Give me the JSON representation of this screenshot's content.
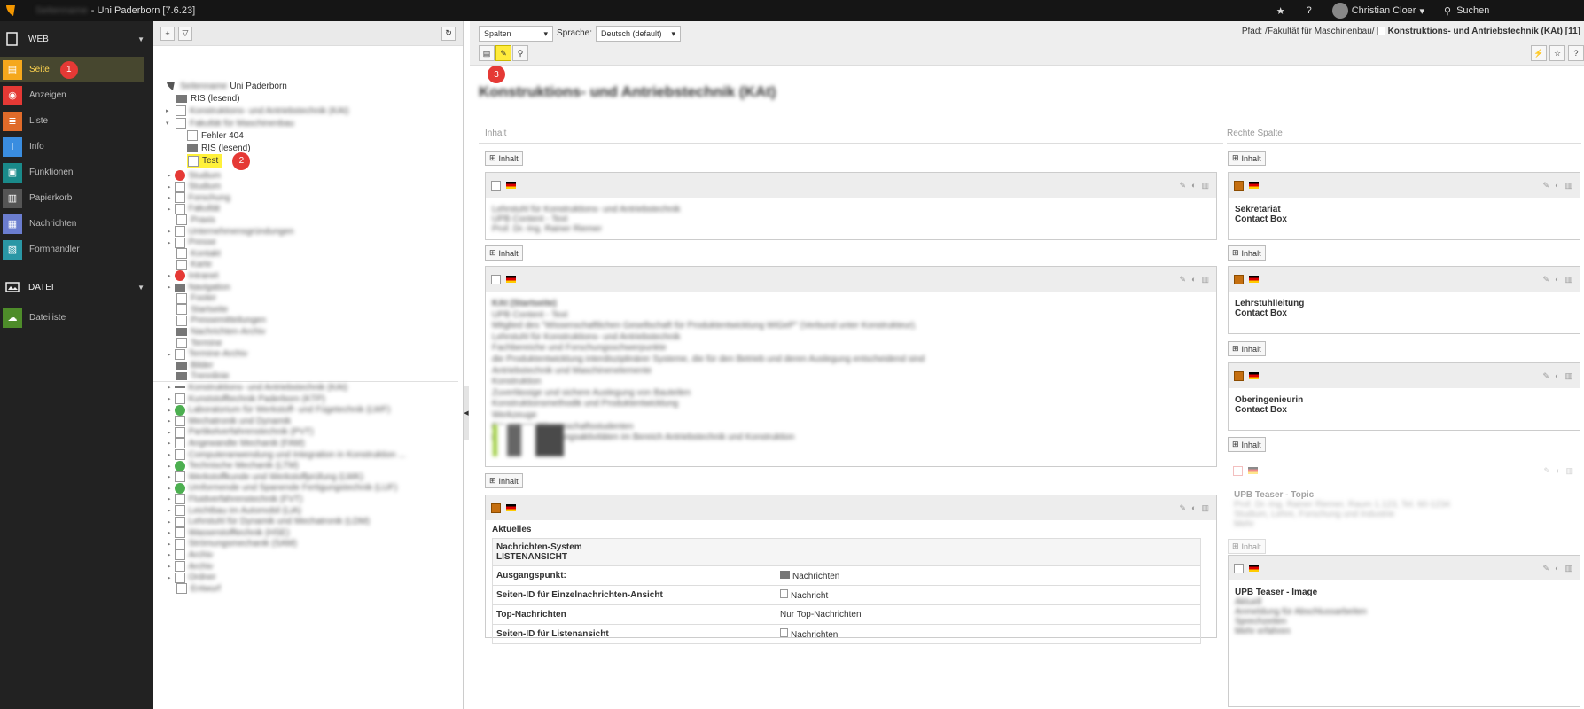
{
  "topbar": {
    "site_name_blurred": "Seitenname",
    "site_name": "- Uni Paderborn [7.6.23]",
    "bookmark_icon": "star-icon",
    "help_icon": "help-icon",
    "user_name": "Christian Cloer",
    "search_label": "Suchen"
  },
  "modules": {
    "web_group": "WEB",
    "file_group": "DATEI",
    "items": [
      {
        "label": "Seite",
        "icon": "page-icon",
        "color": "#f5a81c"
      },
      {
        "label": "Anzeigen",
        "icon": "eye-icon",
        "color": "#e53935"
      },
      {
        "label": "Liste",
        "icon": "list-icon",
        "color": "#e06b2a"
      },
      {
        "label": "Info",
        "icon": "info-icon",
        "color": "#3a8de0"
      },
      {
        "label": "Funktionen",
        "icon": "functions-icon",
        "color": "#1a8a8a"
      },
      {
        "label": "Papierkorb",
        "icon": "trash-icon",
        "color": "#555"
      },
      {
        "label": "Nachrichten",
        "icon": "news-icon",
        "color": "#6b7dcf"
      },
      {
        "label": "Formhandler",
        "icon": "form-icon",
        "color": "#2a97a5"
      }
    ],
    "file_items": [
      {
        "label": "Dateiliste",
        "icon": "filelist-icon",
        "color": "#4e8c2a"
      }
    ],
    "badge1": "1"
  },
  "tree": {
    "root_blurred": "Seitenname",
    "root": "Uni Paderborn",
    "fehler404": "Fehler 404",
    "ris1": "RIS (lesend)",
    "ris2": "RIS (lesend)",
    "test": "Test",
    "badge2": "2",
    "blurred_entries": [
      "Konstruktions- und Antriebstechnik (KAt)",
      "Fakultät für Maschinenbau",
      "Studium",
      "Studium",
      "Forschung",
      "Fakultät",
      "Praxis",
      "Unternehmensgründungen",
      "Presse",
      "Kontakt",
      "Karte",
      "Intranet",
      "Navigation",
      "Footer",
      "Startseite",
      "Pressemitteilungen",
      "Nachrichten-Archiv",
      "Termine",
      "Termine-Archiv",
      "Bilder",
      "Trennlinie",
      "Konstruktions- und Antriebstechnik (KAt)",
      "Kunststofftechnik Paderborn (KTP)",
      "Laboratorium für Werkstoff- und Fügetechnik (LWF)",
      "Mechatronik und Dynamik",
      "Partikelverfahrenstechnik (PVT)",
      "Angewandte Mechanik (FAM)",
      "Computeranwendung und Integration in Konstruktion ...",
      "Technische Mechanik (LTM)",
      "Werkstoffkunde und Werkstoffprüfung (LWK)",
      "Umformende und Spanende Fertigungstechnik (LUF)",
      "Fluidverfahrenstechnik (FVT)",
      "Leichtbau im Automobil (LiA)",
      "Lehrstuhl für Dynamik und Mechatronik (LDM)",
      "Wasserstofftechnik (HSE)",
      "Strömungsmechanik (SAM)",
      "Archiv",
      "Archiv",
      "Ordner",
      "Entwurf"
    ]
  },
  "docheader": {
    "view_select": "Spalten",
    "lang_label": "Sprache:",
    "lang_select": "Deutsch (default)",
    "path_label": "Pfad:",
    "path": "/Fakultät für Maschinenbau/",
    "path_page": "Konstruktions- und Antriebstechnik (KAt) [11]",
    "badge3": "3"
  },
  "page": {
    "title": "Konstruktions- und Antriebstechnik (KAt)",
    "col_left": "Inhalt",
    "col_right": "Rechte Spalte",
    "new_btn": "Inhalt"
  },
  "content_left": {
    "ce1_lines": [
      "Lehrstuhl für Konstruktions- und Antriebstechnik",
      "UPB Content - Text",
      "Prof. Dr.-Ing. Rainer Riemer"
    ],
    "ce2_lines": [
      "KAt (Startseite)",
      "UPB Content - Text",
      "Mitglied des \"Wissenschaftlichen Gesellschaft für Produktentwicklung WiGeP\" (Verbund unter Konstrukteur).",
      "Lehrstuhl für Konstruktions- und Antriebstechnik",
      "Fachbereiche und Forschungsschwerpunkte",
      "die Produktentwicklung interdisziplinärer Systeme, die für den Betrieb und deren Auslegung entscheidend sind",
      "Antriebstechnik und Maschinenelemente",
      "Konstruktion",
      "Zuverlässige und sichere Auslegung von Bauteilen",
      "Konstruktionsmethodik und Produktentwicklung",
      "Werkzeuge",
      "Für unsere Wissenschaftsstudenten",
      "Lehr- und Forschungsaktivitäten im Bereich Antriebstechnik und Konstruktion"
    ],
    "aktuelles": "Aktuelles",
    "news_type": "Nachrichten-System",
    "news_mode": "LISTENANSICHT",
    "rows": [
      {
        "label": "Ausgangspunkt:",
        "value": "Nachrichten",
        "icon": "folder-icon"
      },
      {
        "label": "Seiten-ID für Einzelnachrichten-Ansicht",
        "value": "Nachricht",
        "icon": "page-icon"
      },
      {
        "label": "Top-Nachrichten",
        "value": "Nur Top-Nachrichten",
        "icon": ""
      },
      {
        "label": "Seiten-ID für Listenansicht",
        "value": "Nachrichten",
        "icon": "page-icon"
      }
    ]
  },
  "content_right": {
    "ce1": [
      "Sekretariat",
      "Contact Box"
    ],
    "ce2": [
      "Lehrstuhlleitung",
      "Contact Box"
    ],
    "ce3": [
      "Oberingenieurin",
      "Contact Box"
    ],
    "ce4_title": "UPB Teaser - Topic",
    "ce4_lines": [
      "Prof. Dr.-Ing. Rainer Riemer, Raum 1.123, Tel. 60-1234",
      "Studium, Lehre, Forschung und Industrie",
      "Mehr"
    ],
    "ce5_title": "UPB Teaser - Image",
    "ce5_lines": [
      "Aktuell",
      "Anmeldung für Abschlussarbeiten",
      "Sprechzeiten",
      "Mehr erfahren"
    ]
  }
}
